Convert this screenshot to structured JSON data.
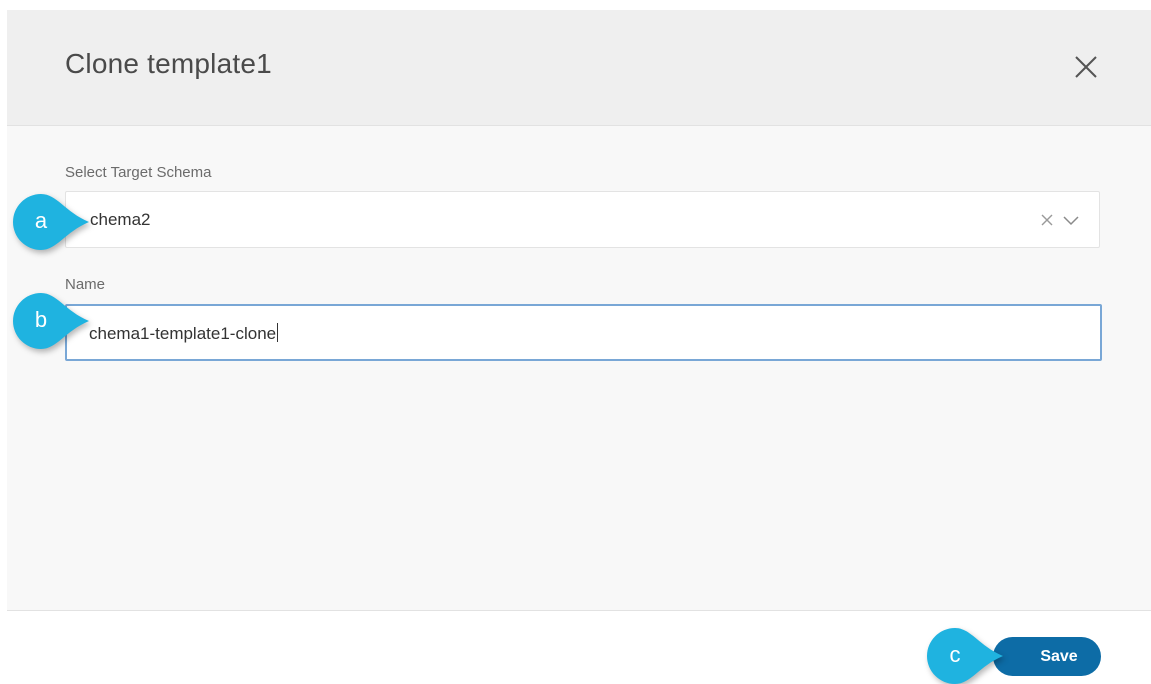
{
  "dialog": {
    "title": "Clone template1"
  },
  "form": {
    "schema_label": "Select Target Schema",
    "schema_value": "chema2",
    "name_label": "Name",
    "name_value": "chema1-template1-clone"
  },
  "footer": {
    "save_label": "Save"
  },
  "callouts": {
    "a": "a",
    "b": "b",
    "c": "c"
  },
  "colors": {
    "callout": "#1fb3e0",
    "primary_button": "#0d6ca6",
    "header_bg": "#efefef",
    "body_bg": "#f8f8f8",
    "focus_border": "#79a7d6"
  },
  "icons": {
    "close": "close-icon",
    "clear": "clear-icon",
    "chevron": "chevron-down-icon"
  }
}
